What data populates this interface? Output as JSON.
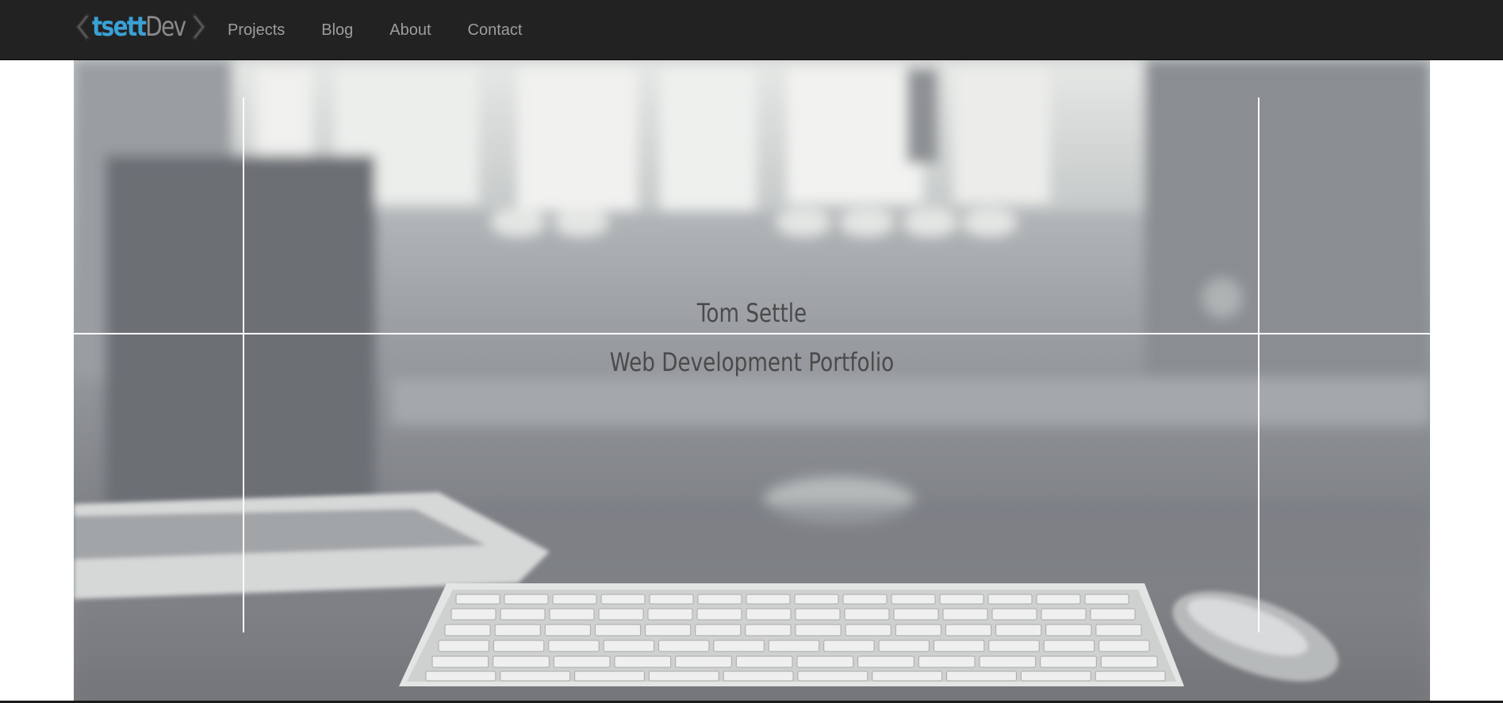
{
  "brand": {
    "logo_part1": "tsett",
    "logo_part2": "Dev",
    "accent_color": "#3aa0d6",
    "muted_color": "#8a8a8a",
    "left_icon": "chevron-left-icon",
    "right_icon": "chevron-right-icon"
  },
  "nav": {
    "items": [
      {
        "label": "Projects"
      },
      {
        "label": "Blog"
      },
      {
        "label": "About"
      },
      {
        "label": "Contact"
      }
    ]
  },
  "hero": {
    "name": "Tom Settle",
    "subtitle": "Web Development Portfolio",
    "background_image": "desk-with-keyboard-mouse-laptop-photo"
  },
  "colors": {
    "navbar_bg": "#222222",
    "nav_text": "#9d9d9d",
    "hero_text": "#4a4a4a",
    "frame_line": "#ffffff"
  }
}
